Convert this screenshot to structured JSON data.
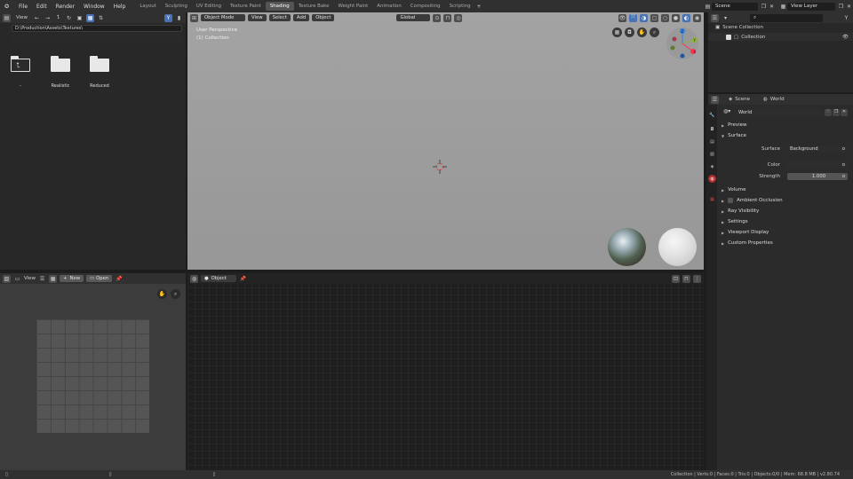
{
  "menu": [
    "File",
    "Edit",
    "Render",
    "Window",
    "Help"
  ],
  "workspaces": [
    "Layout",
    "Sculpting",
    "UV Editing",
    "Texture Paint",
    "Shading",
    "Texture Bake",
    "Weight Paint",
    "Animation",
    "Compositing",
    "Scripting"
  ],
  "active_workspace": "Shading",
  "scene": "Scene",
  "view_layer": "View Layer",
  "file_browser": {
    "view_label": "View",
    "path": "D:\\Production\\Assets\\Textures\\",
    "items": [
      {
        "label": "..",
        "icon": "parent-folder-icon"
      },
      {
        "label": "Realistic",
        "icon": "folder-icon"
      },
      {
        "label": "Reduced",
        "icon": "folder-icon"
      }
    ]
  },
  "viewport": {
    "mode": "Object Mode",
    "menus": [
      "View",
      "Select",
      "Add",
      "Object"
    ],
    "transform_orientation": "Global",
    "overlay_title": "User Perspective",
    "overlay_collection": "(1) Collection",
    "gizmo": {
      "x": "X",
      "y": "Y",
      "z": "Z"
    }
  },
  "image_editor": {
    "view_label": "View",
    "new_label": "New",
    "open_label": "Open"
  },
  "node_editor": {
    "mode": "Object"
  },
  "outliner": {
    "scene_collection": "Scene Collection",
    "collection": "Collection"
  },
  "properties": {
    "scene_tab": "Scene",
    "world_tab": "World",
    "world_name": "World",
    "sections": {
      "preview": "Preview",
      "surface": "Surface",
      "volume": "Volume",
      "ambient_occlusion": "Ambient Occlusion",
      "ray_visibility": "Ray Visibility",
      "settings": "Settings",
      "viewport_display": "Viewport Display",
      "custom_properties": "Custom Properties"
    },
    "surface_label": "Surface",
    "surface_value": "Background",
    "color_label": "Color",
    "strength_label": "Strength",
    "strength_value": "1.000"
  },
  "status_bar": "Collection | Verts:0 | Faces:0 | Tris:0 | Objects:0/0 | Mem: 68.8 MB | v2.80.74",
  "colors": {
    "accent": "#4772b3",
    "header": "#303030",
    "viewport_bg": "#9a9a9a",
    "node_bg": "#1d1d1d"
  }
}
